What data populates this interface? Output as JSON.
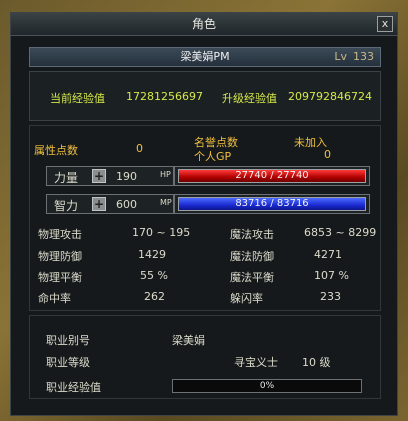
{
  "window": {
    "title": "角色",
    "close": "x"
  },
  "character": {
    "name": "梁美娟PM",
    "level_label": "Lv",
    "level": "133"
  },
  "experience": {
    "current_label": "当前经验值",
    "current_value": "17281256697",
    "next_label": "升级经验值",
    "next_value": "209792846724"
  },
  "points": {
    "attr_label": "属性点数",
    "attr_value": "0",
    "honor_label": "名誉点数",
    "personal_gp_label": "个人GP",
    "not_joined": "未加入",
    "gp_value": "0"
  },
  "strength": {
    "label": "力量",
    "value": "190",
    "bar_label": "HP",
    "bar_text": "27740 / 27740",
    "fill": 1.0
  },
  "intellect": {
    "label": "智力",
    "value": "600",
    "bar_label": "MP",
    "bar_text": "83716 / 83716",
    "fill": 1.0
  },
  "stats": {
    "phys_atk_label": "物理攻击",
    "phys_atk": "170 ~ 195",
    "mag_atk_label": "魔法攻击",
    "mag_atk": "6853 ~ 8299",
    "phys_def_label": "物理防御",
    "phys_def": "1429",
    "mag_def_label": "魔法防御",
    "mag_def": "4271",
    "phys_bal_label": "物理平衡",
    "phys_bal": "55 %",
    "mag_bal_label": "魔法平衡",
    "mag_bal": "107 %",
    "hit_label": "命中率",
    "hit": "262",
    "dodge_label": "躲闪率",
    "dodge": "233"
  },
  "job": {
    "alias_label": "职业别号",
    "alias": "梁美娟",
    "level_label": "职业等级",
    "class_name": "寻宝义士",
    "class_level": "10 级",
    "exp_label": "职业经验值",
    "exp_text": "0%",
    "exp_fill": 0.0
  },
  "colors": {
    "hp": "#d01010",
    "mp": "#2030e0",
    "label_green": "#d6e84a",
    "label_orange": "#f0c040"
  }
}
